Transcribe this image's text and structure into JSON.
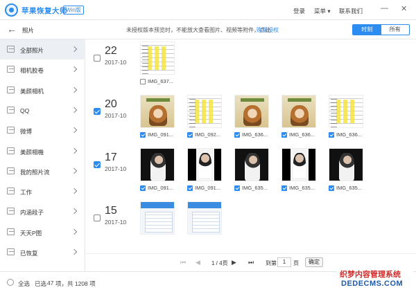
{
  "app": {
    "title": "苹果恢复大师",
    "badge": "Win版"
  },
  "titlebar": {
    "login": "登录",
    "menu": "菜单 ▾",
    "contact": "联系我们",
    "min": "—",
    "close": "✕"
  },
  "toolbar": {
    "title": "照片",
    "notice": "未授权版本预览时，不能放大查看图片、视频等附件，点此",
    "buy_link": "购买授权",
    "tabs": [
      {
        "label": "时刻",
        "active": true
      },
      {
        "label": "所有",
        "active": false
      }
    ]
  },
  "sidebar": {
    "items": [
      {
        "label": "全部照片",
        "active": true
      },
      {
        "label": "相机胶卷",
        "active": false
      },
      {
        "label": "美颜相机",
        "active": false
      },
      {
        "label": "QQ",
        "active": false
      },
      {
        "label": "微博",
        "active": false
      },
      {
        "label": "美颜相機",
        "active": false
      },
      {
        "label": "我的照片流",
        "active": false
      },
      {
        "label": "工作",
        "active": false
      },
      {
        "label": "内涵段子",
        "active": false
      },
      {
        "label": "天天P图",
        "active": false
      },
      {
        "label": "已恢复",
        "active": false
      }
    ]
  },
  "groups": [
    {
      "day": "22",
      "month": "2017-10",
      "checked": false,
      "photos": [
        {
          "caption": "IMG_637...",
          "kind": "sheet",
          "checked": false
        }
      ]
    },
    {
      "day": "20",
      "month": "2017-10",
      "checked": true,
      "photos": [
        {
          "caption": "IMG_091...",
          "kind": "cover",
          "checked": true
        },
        {
          "caption": "IMG_092...",
          "kind": "sheet",
          "checked": true
        },
        {
          "caption": "IMG_636...",
          "kind": "cover",
          "checked": true
        },
        {
          "caption": "IMG_636...",
          "kind": "cover",
          "checked": true
        },
        {
          "caption": "IMG_636...",
          "kind": "sheet",
          "checked": true
        }
      ]
    },
    {
      "day": "17",
      "month": "2017-10",
      "checked": true,
      "photos": [
        {
          "caption": "IMG_091...",
          "kind": "dark",
          "checked": true
        },
        {
          "caption": "IMG_091...",
          "kind": "whitebar",
          "checked": true
        },
        {
          "caption": "IMG_635...",
          "kind": "dark",
          "checked": true
        },
        {
          "caption": "IMG_635...",
          "kind": "whitebar",
          "checked": true
        },
        {
          "caption": "IMG_635...",
          "kind": "dark",
          "checked": true
        }
      ]
    },
    {
      "day": "15",
      "month": "2017-10",
      "checked": false,
      "photos": [
        {
          "caption": "",
          "kind": "phone",
          "checked": false
        },
        {
          "caption": "",
          "kind": "phone",
          "checked": false
        }
      ]
    }
  ],
  "pager": {
    "first": "⏮",
    "prev": "◀",
    "info": "1 / 4页",
    "next": "▶",
    "last": "⏭",
    "goto": "到第",
    "page_value": "1",
    "page_unit": "页",
    "ok": "确定"
  },
  "status": {
    "select_all": "全选",
    "selected_prefix": "已选",
    "selected_count": "47",
    "selected_suffix": "项，共 1208 项"
  },
  "watermark": {
    "line1": "织梦内容管理系统",
    "line2": "DEDECMS.COM"
  },
  "colors": {
    "accent": "#2d8cf0",
    "sidebar_active": "#eceff3"
  }
}
